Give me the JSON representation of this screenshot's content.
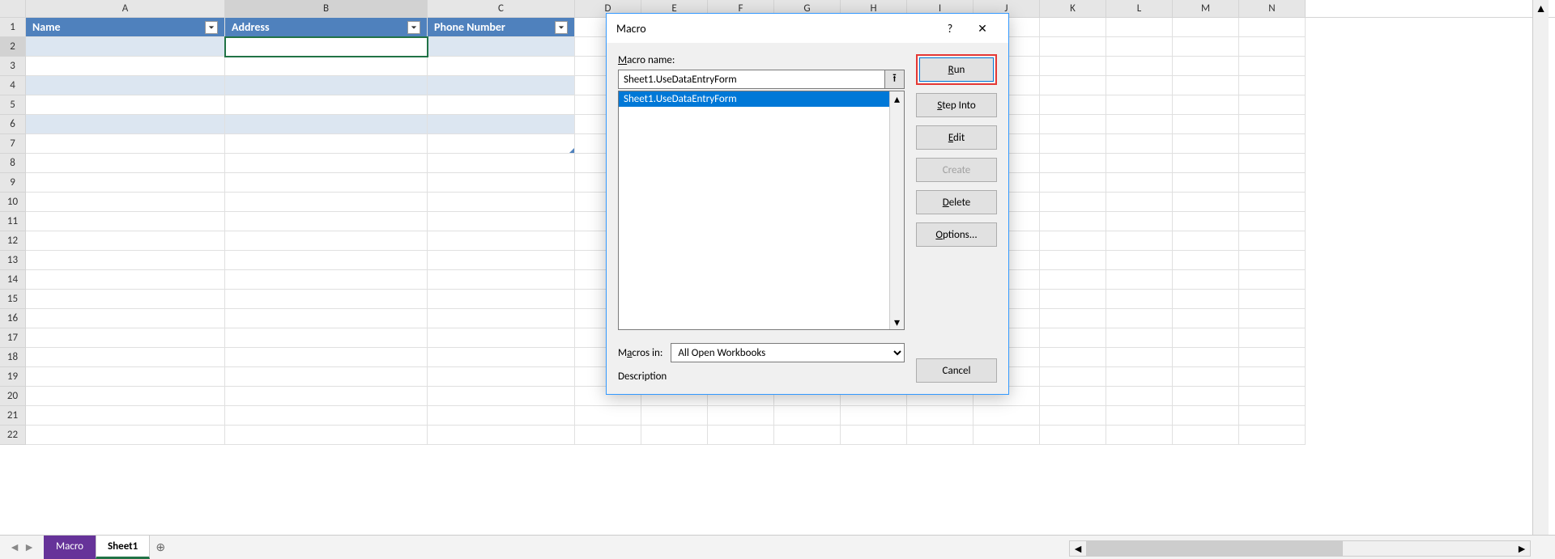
{
  "columns": [
    "A",
    "B",
    "C",
    "D",
    "E",
    "F",
    "G",
    "H",
    "I",
    "J",
    "K",
    "L",
    "M",
    "N"
  ],
  "rows": [
    "1",
    "2",
    "3",
    "4",
    "5",
    "6",
    "7",
    "8",
    "9",
    "10",
    "11",
    "12",
    "13",
    "14",
    "15",
    "16",
    "17",
    "18",
    "19",
    "20",
    "21",
    "22"
  ],
  "tableHeaders": {
    "A": "Name",
    "B": "Address",
    "C": "Phone Number"
  },
  "activeCell": "B2",
  "sheetTabs": {
    "macro": "Macro",
    "active": "Sheet1"
  },
  "dialog": {
    "title": "Macro",
    "macroNameLabel": "Macro name:",
    "macroNameValue": "Sheet1.UseDataEntryForm",
    "listItems": [
      "Sheet1.UseDataEntryForm"
    ],
    "macrosInLabel": "Macros in:",
    "macrosInValue": "All Open Workbooks",
    "descriptionLabel": "Description",
    "buttons": {
      "run": "Run",
      "stepInto": "Step Into",
      "edit": "Edit",
      "create": "Create",
      "delete": "Delete",
      "options": "Options...",
      "cancel": "Cancel"
    }
  }
}
